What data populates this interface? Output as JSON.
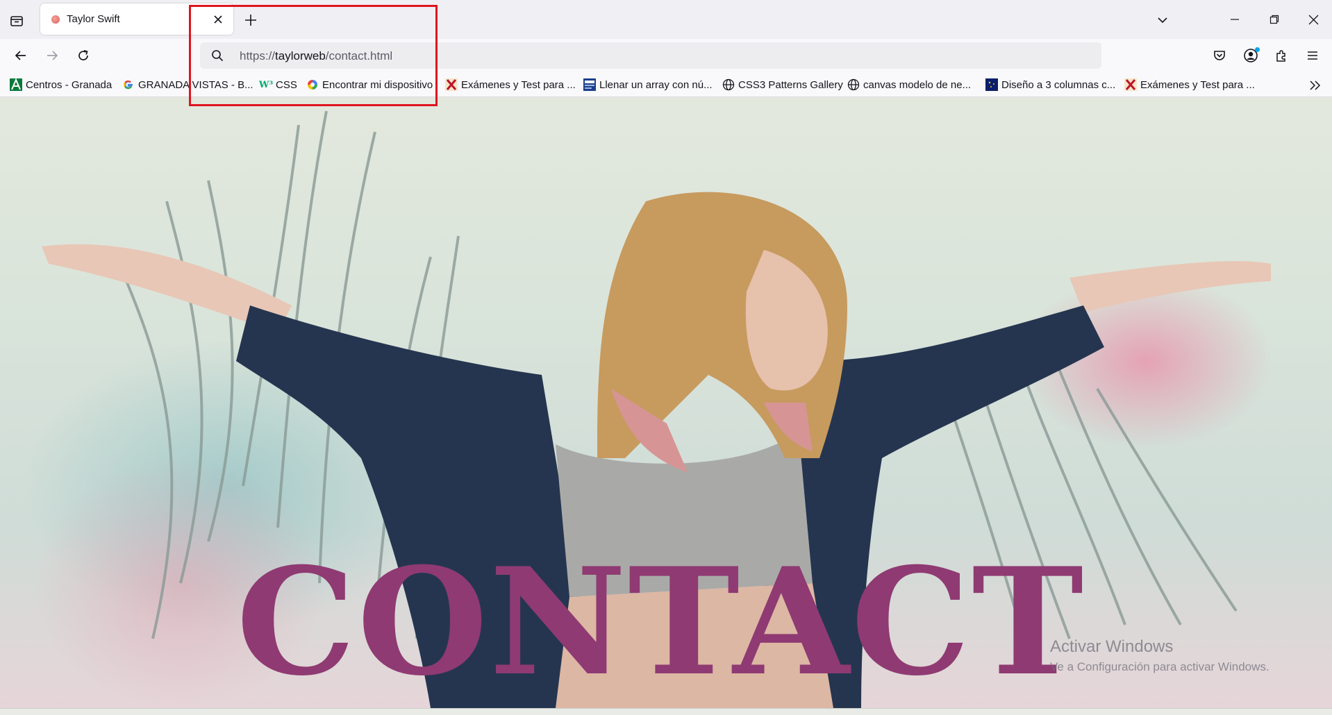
{
  "tab": {
    "title": "Taylor Swift"
  },
  "urlbar": {
    "scheme": "https://",
    "domain": "taylorweb",
    "path": "/contact.html"
  },
  "bookmarks": [
    {
      "label": "Centros - Granada",
      "icon": "andalucia-icon"
    },
    {
      "label": "GRANADA VISTAS - B...",
      "icon": "google-icon"
    },
    {
      "label": "CSS",
      "icon": "w3schools-icon"
    },
    {
      "label": "Encontrar mi dispositivo",
      "icon": "google-find-device-icon"
    },
    {
      "label": "Exámenes y Test para ...",
      "icon": "x-logo-icon"
    },
    {
      "label": "Llenar un array con nú...",
      "icon": "site-thumbnail-icon"
    },
    {
      "label": "CSS3 Patterns Gallery",
      "icon": "globe-icon"
    },
    {
      "label": "canvas modelo de ne...",
      "icon": "globe-icon"
    },
    {
      "label": "Diseño a 3 columnas c...",
      "icon": "site-thumbnail-icon"
    },
    {
      "label": "Exámenes y Test para ...",
      "icon": "x-logo-icon"
    }
  ],
  "page": {
    "heading": "CONTACT"
  },
  "watermark": {
    "title": "Activar Windows",
    "subtitle": "Ve a Configuración para activar Windows."
  },
  "colors": {
    "heading": "#8f3a72",
    "highlight": "#e0141e",
    "tab_bar": "#f0f0f4",
    "toolbar": "#f9f9fb"
  }
}
